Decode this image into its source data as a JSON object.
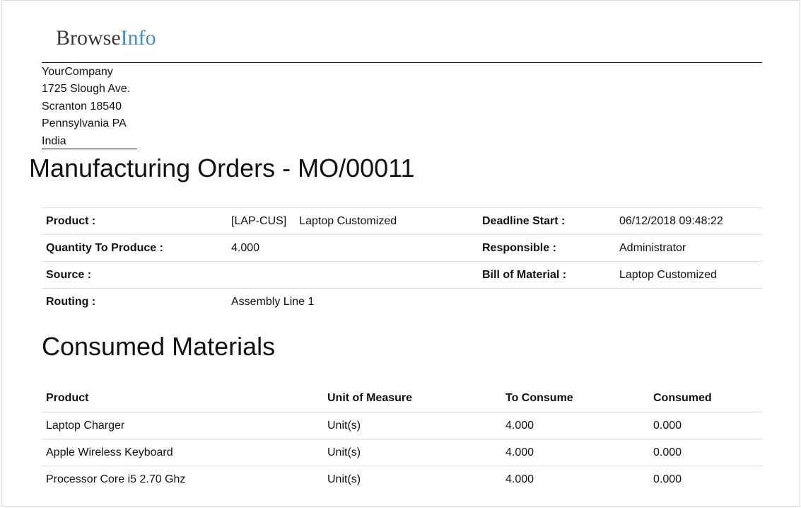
{
  "logo": {
    "part1": "Browse",
    "part2": "Info"
  },
  "company": {
    "name": "YourCompany",
    "street": "1725 Slough Ave.",
    "city": "Scranton 18540",
    "state": "Pennsylvania PA",
    "country": "India"
  },
  "title": "Manufacturing Orders - MO/00011",
  "details": {
    "product_label": "Product :",
    "product_code": "[LAP-CUS]",
    "product_name": "Laptop Customized",
    "deadline_label": "Deadline Start :",
    "deadline_value": "06/12/2018 09:48:22",
    "qty_label": "Quantity To Produce :",
    "qty_value": "4.000",
    "responsible_label": "Responsible :",
    "responsible_value": "Administrator",
    "source_label": "Source :",
    "source_value": "",
    "bom_label": "Bill of Material :",
    "bom_value": "Laptop Customized",
    "routing_label": "Routing :",
    "routing_value": "Assembly Line 1"
  },
  "consumed": {
    "title": "Consumed Materials",
    "headers": [
      "Product",
      "Unit of Measure",
      "To Consume",
      "Consumed"
    ],
    "rows": [
      [
        "Laptop Charger",
        "Unit(s)",
        "4.000",
        "0.000"
      ],
      [
        "Apple Wireless Keyboard",
        "Unit(s)",
        "4.000",
        "0.000"
      ],
      [
        "Processor Core i5 2.70 Ghz",
        "Unit(s)",
        "4.000",
        "0.000"
      ]
    ]
  }
}
